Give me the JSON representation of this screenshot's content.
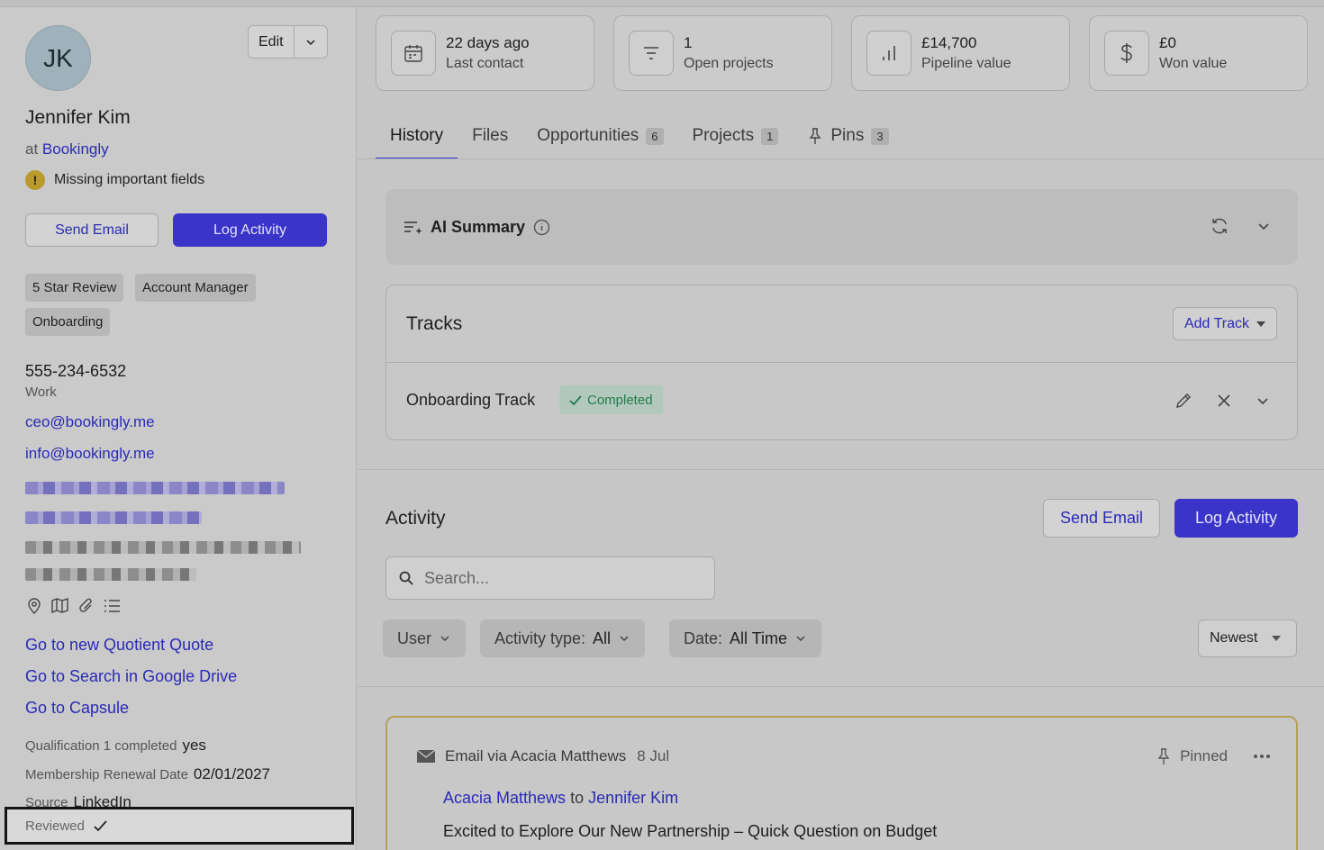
{
  "contact": {
    "initials": "JK",
    "name": "Jennifer Kim",
    "company_prefix": "at",
    "company": "Bookingly",
    "warning": "Missing important fields",
    "edit_label": "Edit",
    "send_email": "Send Email",
    "log_activity": "Log Activity",
    "tags": [
      "5 Star Review",
      "Account Manager",
      "Onboarding"
    ],
    "phone": "555-234-6532",
    "phone_label": "Work",
    "emails": [
      "ceo@bookingly.me",
      "info@bookingly.me"
    ],
    "links": [
      "Go to new Quotient Quote",
      "Go to Search in Google Drive",
      "Go to Capsule"
    ],
    "fields": [
      {
        "label": "Qualification 1 completed",
        "value": "yes"
      },
      {
        "label": "Membership Renewal Date",
        "value": "02/01/2027"
      },
      {
        "label": "Source",
        "value": "LinkedIn"
      }
    ],
    "reviewed_label": "Reviewed"
  },
  "stats": [
    {
      "value": "22 days ago",
      "label": "Last contact",
      "icon": "calendar-icon"
    },
    {
      "value": "1",
      "label": "Open projects",
      "icon": "list-icon"
    },
    {
      "value": "£14,700",
      "label": "Pipeline value",
      "icon": "bar-chart-icon"
    },
    {
      "value": "£0",
      "label": "Won value",
      "icon": "dollar-icon"
    }
  ],
  "tabs": [
    {
      "label": "History",
      "badge": ""
    },
    {
      "label": "Files",
      "badge": ""
    },
    {
      "label": "Opportunities",
      "badge": "6"
    },
    {
      "label": "Projects",
      "badge": "1"
    },
    {
      "label": "Pins",
      "badge": "3"
    }
  ],
  "ai_summary": {
    "title": "AI Summary"
  },
  "tracks": {
    "title": "Tracks",
    "add_label": "Add Track",
    "items": [
      {
        "name": "Onboarding Track",
        "status": "Completed"
      }
    ]
  },
  "activity": {
    "title": "Activity",
    "send_email": "Send Email",
    "log_activity": "Log Activity",
    "search_placeholder": "Search...",
    "filters": {
      "user": "User",
      "type_label": "Activity type:",
      "type_value": "All",
      "date_label": "Date:",
      "date_value": "All Time"
    },
    "sort": "Newest",
    "item": {
      "channel": "Email via Acacia Matthews",
      "date": "8 Jul",
      "pinned": "Pinned",
      "from": "Acacia Matthews",
      "to_word": "to",
      "to": "Jennifer Kim",
      "subject": "Excited to Explore Our New Partnership – Quick Question on Budget"
    }
  }
}
